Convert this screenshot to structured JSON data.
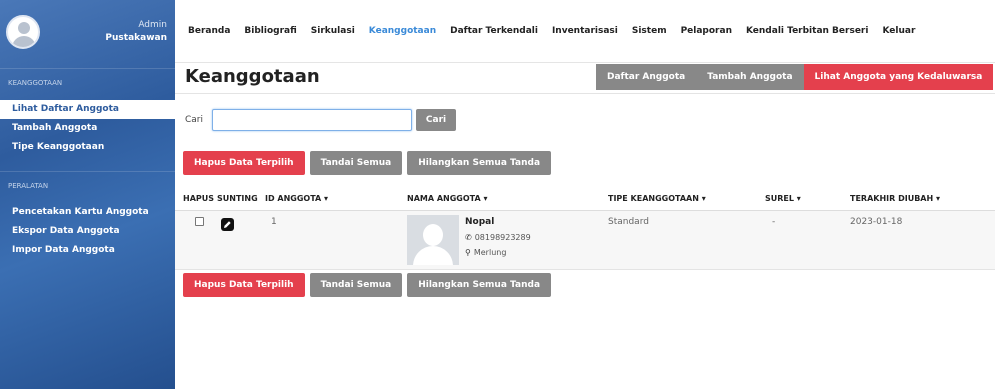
{
  "sidebar": {
    "profile": {
      "role": "Admin",
      "name": "Pustakawan"
    },
    "section1_title": "KEANGGOTAAN",
    "section1_items": [
      {
        "label": "Lihat Daftar Anggota",
        "active": true
      },
      {
        "label": "Tambah Anggota",
        "active": false
      },
      {
        "label": "Tipe Keanggotaan",
        "active": false
      }
    ],
    "section2_title": "PERALATAN",
    "section2_items": [
      {
        "label": "Pencetakan Kartu Anggota"
      },
      {
        "label": "Ekspor Data Anggota"
      },
      {
        "label": "Impor Data Anggota"
      }
    ]
  },
  "topnav": {
    "items": [
      "Beranda",
      "Bibliografi",
      "Sirkulasi",
      "Keanggotaan",
      "Daftar Terkendali",
      "Inventarisasi",
      "Sistem",
      "Pelaporan",
      "Kendali Terbitan Berseri",
      "Keluar"
    ],
    "active_index": 3
  },
  "main": {
    "title": "Keanggotaan",
    "tabs": [
      "Daftar Anggota",
      "Tambah Anggota",
      "Lihat Anggota yang Kedaluwarsa"
    ],
    "search": {
      "label": "Cari",
      "value": "",
      "button": "Cari"
    },
    "actions": {
      "delete_selected": "Hapus Data Terpilih",
      "mark_all": "Tandai Semua",
      "unmark_all": "Hilangkan Semua Tanda"
    },
    "table": {
      "headers": {
        "delete": "HAPUS",
        "edit": "SUNTING",
        "id": "ID ANGGOTA ▾",
        "name": "NAMA ANGGOTA ▾",
        "type": "TIPE KEANGGOTAAN ▾",
        "email": "SUREL ▾",
        "updated": "TERAKHIR DIUBAH ▾"
      },
      "rows": [
        {
          "id": "1",
          "name": "Nopal",
          "phone": "08198923289",
          "address": "Merlung",
          "type": "Standard",
          "email": "-",
          "updated": "2023-01-18"
        }
      ]
    }
  },
  "colors": {
    "accent": "#3a8ad8",
    "danger": "#e4404d",
    "neutral_button": "#888888",
    "sidebar": "#2e5c9e"
  },
  "icons": {
    "phone": "phone-icon",
    "location": "map-marker-icon",
    "edit": "pencil-icon"
  }
}
